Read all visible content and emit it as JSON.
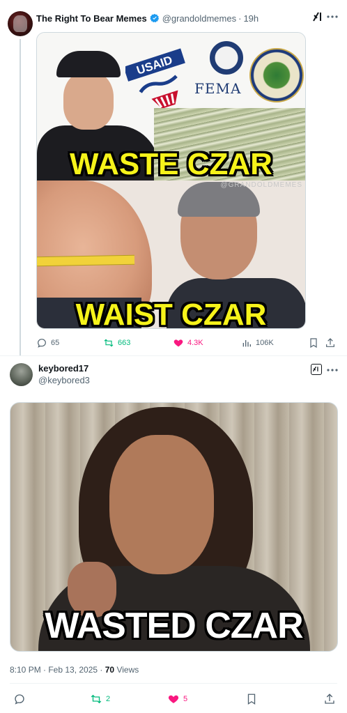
{
  "tweet1": {
    "display_name": "The Right To Bear Memes",
    "handle": "@grandoldmemes",
    "separator": "·",
    "time": "19h",
    "verified_color": "#1d9bf0",
    "media": {
      "logo_usaid": "USAID",
      "logo_fema": "FEMA",
      "caption_top": "WASTE CZAR",
      "caption_bottom": "WAIST CZAR",
      "watermark": "@GRANDOLDMEMES"
    },
    "actions": {
      "replies": "65",
      "reposts": "663",
      "likes": "4.3K",
      "views": "106K"
    }
  },
  "tweet2": {
    "display_name": "keybored17",
    "handle": "@keybored3",
    "media": {
      "caption": "WASTED CZAR"
    },
    "meta": {
      "timestamp": "8:10 PM · Feb 13, 2025 · ",
      "views_count": "70",
      "views_label": " Views"
    },
    "actions": {
      "reposts": "2",
      "likes": "5"
    }
  },
  "colors": {
    "text_primary": "#0f1419",
    "text_secondary": "#536471",
    "repost_green": "#00ba7c",
    "like_pink": "#f91880",
    "caption_yellow": "#f6f31a"
  }
}
